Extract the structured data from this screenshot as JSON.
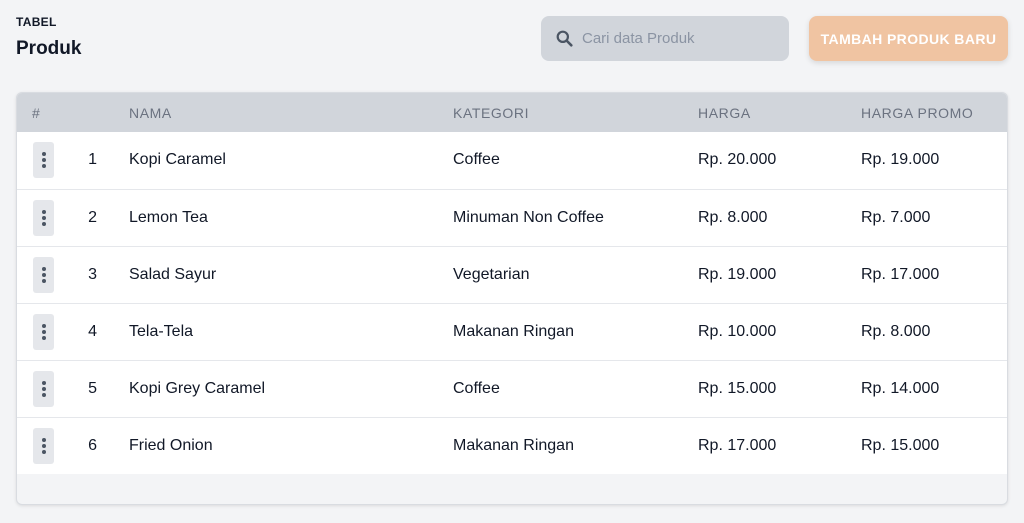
{
  "header": {
    "label": "TABEL",
    "title": "Produk"
  },
  "search": {
    "placeholder": "Cari data Produk",
    "icon": "search-icon"
  },
  "actions": {
    "add_label": "TAMBAH PRODUK BARU",
    "accent": "#f0c4a2"
  },
  "table": {
    "columns": [
      "#",
      "NAMA",
      "KATEGORI",
      "HARGA",
      "HARGA PROMO"
    ],
    "rows": [
      {
        "no": "1",
        "nama": "Kopi Caramel",
        "kategori": "Coffee",
        "harga": "Rp. 20.000",
        "promo": "Rp. 19.000"
      },
      {
        "no": "2",
        "nama": "Lemon Tea",
        "kategori": "Minuman Non Coffee",
        "harga": "Rp. 8.000",
        "promo": "Rp. 7.000"
      },
      {
        "no": "3",
        "nama": "Salad Sayur",
        "kategori": "Vegetarian",
        "harga": "Rp. 19.000",
        "promo": "Rp. 17.000"
      },
      {
        "no": "4",
        "nama": "Tela-Tela",
        "kategori": "Makanan Ringan",
        "harga": "Rp. 10.000",
        "promo": "Rp. 8.000"
      },
      {
        "no": "5",
        "nama": "Kopi Grey Caramel",
        "kategori": "Coffee",
        "harga": "Rp. 15.000",
        "promo": "Rp. 14.000"
      },
      {
        "no": "6",
        "nama": "Fried Onion",
        "kategori": "Makanan Ringan",
        "harga": "Rp. 17.000",
        "promo": "Rp. 15.000"
      }
    ]
  }
}
